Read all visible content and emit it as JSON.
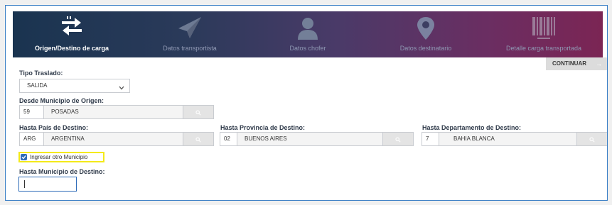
{
  "steps": [
    {
      "label": "Origen/Destino de carga",
      "icon": "swap-arrows-icon"
    },
    {
      "label": "Datos transportista",
      "icon": "paper-plane-icon"
    },
    {
      "label": "Datos chofer",
      "icon": "person-icon"
    },
    {
      "label": "Datos destinatario",
      "icon": "location-pin-icon"
    },
    {
      "label": "Detalle carga transportada",
      "icon": "barcode-icon"
    }
  ],
  "continue_label": "CONTINUAR",
  "continue_arrow": "→",
  "tipo_traslado": {
    "label": "Tipo Traslado:",
    "value": "SALIDA"
  },
  "origen": {
    "label": "Desde Municipio de Origen:",
    "code": "59",
    "name": "POSADAS"
  },
  "pais": {
    "label": "Hasta País de Destino:",
    "code": "ARG",
    "name": "ARGENTINA"
  },
  "provincia": {
    "label": "Hasta Provincia de Destino:",
    "code": "02",
    "name": "BUENOS AIRES"
  },
  "departamento": {
    "label": "Hasta Departamento de Destino:",
    "code": "7",
    "name": "BAHIA BLANCA"
  },
  "otro_municipio": {
    "label": "Ingresar otro Municipio",
    "checked": true
  },
  "municipio_destino": {
    "label": "Hasta Municipio de Destino:",
    "value": ""
  }
}
